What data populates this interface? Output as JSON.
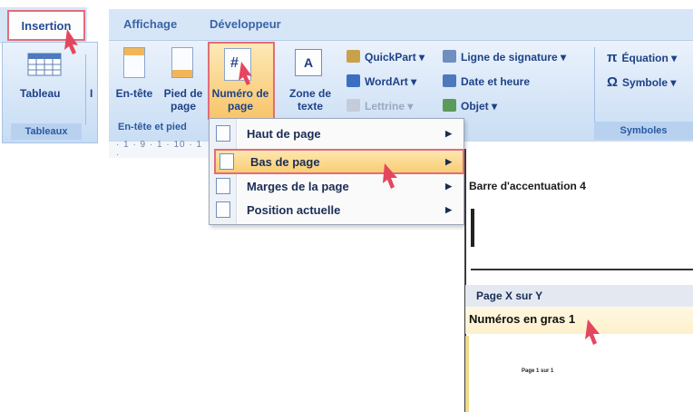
{
  "tabs": {
    "insertion": "Insertion",
    "affichage": "Affichage",
    "developpeur": "Développeur"
  },
  "left_ribbon": {
    "tableau_label": "Tableau",
    "partial_label": "I",
    "group_label": "Tableaux"
  },
  "ribbon": {
    "entete_label": "En-tête",
    "pied_label": "Pied de page",
    "numero_label": "Numéro de page",
    "zone_label": "Zone de texte",
    "group_entete": "En-tête et pied",
    "quickpart": "QuickPart",
    "wordart": "WordArt",
    "lettrine": "Lettrine",
    "signature": "Ligne de signature",
    "date": "Date et heure",
    "objet": "Objet",
    "equation": "Équation",
    "symbole": "Symbole",
    "group_symboles": "Symboles"
  },
  "ruler": "· 1 · 9 · 1 · 10 · 1 ·",
  "menu": {
    "items": [
      {
        "label": "Haut de page"
      },
      {
        "label": "Bas de page"
      },
      {
        "label": "Marges de la page"
      },
      {
        "label": "Position actuelle"
      }
    ]
  },
  "gallery": {
    "entry1": "Barre d'accentuation 4",
    "header": "Page X sur Y",
    "selected": "Numéros en gras 1",
    "preview_text": "Page 1 sur 1"
  },
  "colors": {
    "highlight_border": "#e06d7c",
    "ribbon_text": "#1d4287",
    "arrow": "#e5465f"
  }
}
